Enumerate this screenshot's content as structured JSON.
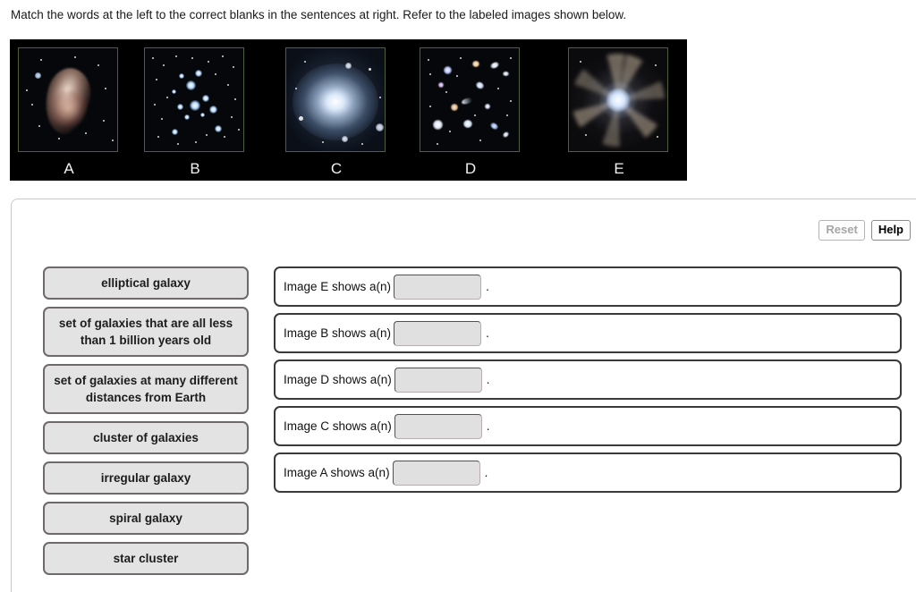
{
  "instruction": "Match the words at the left to the correct blanks in the sentences at right. Refer to the labeled images shown below.",
  "images": [
    {
      "label": "A",
      "kind": "irregular-galaxy-thumbnail"
    },
    {
      "label": "B",
      "kind": "star-cluster-thumbnail"
    },
    {
      "label": "C",
      "kind": "elliptical-galaxy-thumbnail"
    },
    {
      "label": "D",
      "kind": "galaxy-cluster-thumbnail"
    },
    {
      "label": "E",
      "kind": "spiral-galaxy-thumbnail"
    }
  ],
  "toolbar": {
    "reset_label": "Reset",
    "reset_disabled": true,
    "help_label": "Help",
    "help_disabled": false
  },
  "wordbank": {
    "tiles": [
      {
        "text": "elliptical galaxy"
      },
      {
        "text": "set of galaxies that are all less than 1 billion years old"
      },
      {
        "text": "set of galaxies at many different distances from Earth"
      },
      {
        "text": "cluster of galaxies"
      },
      {
        "text": "irregular galaxy"
      },
      {
        "text": "spiral galaxy"
      },
      {
        "text": "star cluster"
      }
    ]
  },
  "sentences": {
    "rows": [
      {
        "prefix": "Image E shows a(n)",
        "answer": "",
        "suffix": "."
      },
      {
        "prefix": "Image B shows a(n)",
        "answer": "",
        "suffix": "."
      },
      {
        "prefix": "Image D shows a(n)",
        "answer": "",
        "suffix": "."
      },
      {
        "prefix": "Image C shows a(n)",
        "answer": "",
        "suffix": "."
      },
      {
        "prefix": "Image A shows a(n)",
        "answer": "",
        "suffix": "."
      }
    ]
  },
  "colors": {
    "tile_fill": "#e3e3e3",
    "tile_border": "#6e6a6a",
    "row_border": "#3a3a3a",
    "blank_fill": "#e0e0e0",
    "panel_border": "#c8c8c8",
    "strip_background": "#000000",
    "thumb_frame": "#4d5f3c"
  }
}
